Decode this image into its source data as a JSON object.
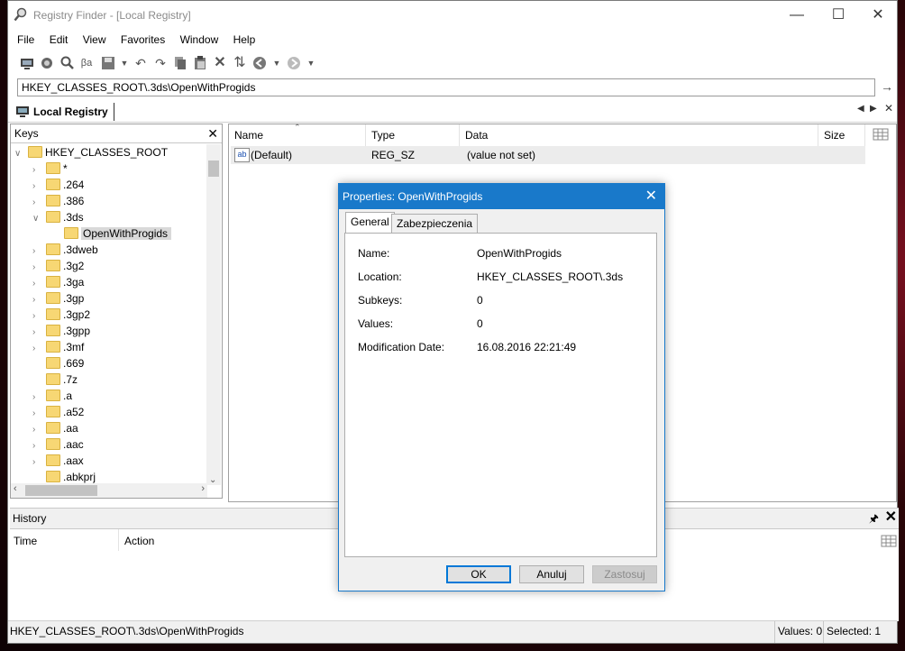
{
  "window": {
    "title": "Registry Finder - [Local Registry]"
  },
  "menu": [
    "File",
    "Edit",
    "View",
    "Favorites",
    "Window",
    "Help"
  ],
  "address": {
    "value": "HKEY_CLASSES_ROOT\\.3ds\\OpenWithProgids"
  },
  "doc_tab": {
    "label": "Local Registry"
  },
  "keys_panel": {
    "title": "Keys",
    "tree": [
      {
        "label": "HKEY_CLASSES_ROOT",
        "level": 0,
        "expander": "expanded"
      },
      {
        "label": "*",
        "level": 1,
        "expander": "collapsed"
      },
      {
        "label": ".264",
        "level": 1,
        "expander": "collapsed"
      },
      {
        "label": ".386",
        "level": 1,
        "expander": "collapsed"
      },
      {
        "label": ".3ds",
        "level": 1,
        "expander": "expanded"
      },
      {
        "label": "OpenWithProgids",
        "level": 2,
        "expander": "none",
        "selected": true
      },
      {
        "label": ".3dweb",
        "level": 1,
        "expander": "collapsed"
      },
      {
        "label": ".3g2",
        "level": 1,
        "expander": "collapsed"
      },
      {
        "label": ".3ga",
        "level": 1,
        "expander": "collapsed"
      },
      {
        "label": ".3gp",
        "level": 1,
        "expander": "collapsed"
      },
      {
        "label": ".3gp2",
        "level": 1,
        "expander": "collapsed"
      },
      {
        "label": ".3gpp",
        "level": 1,
        "expander": "collapsed"
      },
      {
        "label": ".3mf",
        "level": 1,
        "expander": "collapsed"
      },
      {
        "label": ".669",
        "level": 1,
        "expander": "none"
      },
      {
        "label": ".7z",
        "level": 1,
        "expander": "none"
      },
      {
        "label": ".a",
        "level": 1,
        "expander": "collapsed"
      },
      {
        "label": ".a52",
        "level": 1,
        "expander": "collapsed"
      },
      {
        "label": ".aa",
        "level": 1,
        "expander": "collapsed"
      },
      {
        "label": ".aac",
        "level": 1,
        "expander": "collapsed"
      },
      {
        "label": ".aax",
        "level": 1,
        "expander": "collapsed"
      },
      {
        "label": ".abkprj",
        "level": 1,
        "expander": "none"
      }
    ]
  },
  "values_list": {
    "columns": {
      "name": "Name",
      "type": "Type",
      "data": "Data",
      "size": "Size"
    },
    "rows": [
      {
        "icon": "string-value-icon",
        "name": "(Default)",
        "type": "REG_SZ",
        "data": "(value not set)",
        "size": ""
      }
    ]
  },
  "history": {
    "title": "History",
    "columns": {
      "time": "Time",
      "action": "Action"
    }
  },
  "status": {
    "path": "HKEY_CLASSES_ROOT\\.3ds\\OpenWithProgids",
    "values": "Values: 0",
    "selected": "Selected: 1"
  },
  "dialog": {
    "title": "Properties: OpenWithProgids",
    "tabs": [
      "General",
      "Zabezpieczenia"
    ],
    "properties": [
      {
        "label": "Name:",
        "value": "OpenWithProgids"
      },
      {
        "label": "Location:",
        "value": "HKEY_CLASSES_ROOT\\.3ds"
      },
      {
        "label": "Subkeys:",
        "value": "0"
      },
      {
        "label": "Values:",
        "value": "0"
      },
      {
        "label": "Modification Date:",
        "value": "16.08.2016 22:21:49"
      }
    ],
    "buttons": {
      "ok": "OK",
      "cancel": "Anuluj",
      "apply": "Zastosuj"
    }
  },
  "colors": {
    "accent": "#1979ca",
    "folder": "#f7d774",
    "selection": "#d9d9d9"
  }
}
